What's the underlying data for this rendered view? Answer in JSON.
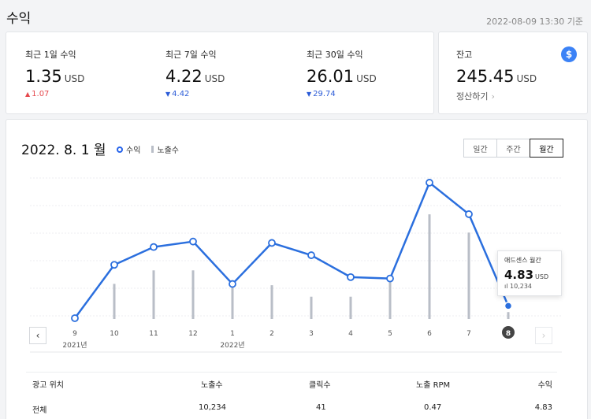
{
  "header": {
    "title": "수익",
    "timestamp": "2022-08-09 13:30 기준"
  },
  "stats": [
    {
      "label": "최근 1일 수익",
      "value": "1.35",
      "unit": "USD",
      "delta": "1.07",
      "direction": "up"
    },
    {
      "label": "최근 7일 수익",
      "value": "4.22",
      "unit": "USD",
      "delta": "4.42",
      "direction": "down"
    },
    {
      "label": "최근 30일 수익",
      "value": "26.01",
      "unit": "USD",
      "delta": "29.74",
      "direction": "down"
    }
  ],
  "balance": {
    "label": "잔고",
    "value": "245.45",
    "unit": "USD",
    "link": "정산하기",
    "icon": "dollar-icon"
  },
  "chart_header": {
    "date": "2022. 8. 1 월",
    "legend": {
      "revenue": "수익",
      "impressions": "노출수"
    },
    "periods": [
      "일간",
      "주간",
      "월간"
    ],
    "active_period": "월간"
  },
  "chart_data": {
    "type": "line",
    "categories": [
      "9",
      "10",
      "11",
      "12",
      "1",
      "2",
      "3",
      "4",
      "5",
      "6",
      "7",
      "8"
    ],
    "year_labels": [
      {
        "index": 0,
        "label": "2021년"
      },
      {
        "index": 4,
        "label": "2022년"
      }
    ],
    "series": [
      {
        "name": "수익",
        "type": "line",
        "values": [
          0,
          3.9,
          5.2,
          5.6,
          2.5,
          5.5,
          4.6,
          3.0,
          2.9,
          9.9,
          7.6,
          0.9
        ]
      },
      {
        "name": "노출수",
        "type": "bar",
        "values": [
          0,
          52000,
          72000,
          72000,
          48000,
          50000,
          33000,
          33000,
          62000,
          155000,
          128000,
          10234
        ]
      }
    ],
    "selected_index": 11,
    "colors": {
      "line": "#2b6fde",
      "bar": "#b9bec7",
      "selected": "#2b6fde"
    },
    "grid": true
  },
  "tooltip": {
    "label": "애드센스 월간",
    "value": "4.83",
    "unit": "USD",
    "impressions": "10,234"
  },
  "table": {
    "headers": [
      "광고 위치",
      "노출수",
      "클릭수",
      "노출 RPM",
      "수익"
    ],
    "rows": [
      [
        "전체",
        "10,234",
        "41",
        "0.47",
        "4.83"
      ]
    ]
  },
  "nav": {
    "prev": "‹",
    "next": "›"
  }
}
